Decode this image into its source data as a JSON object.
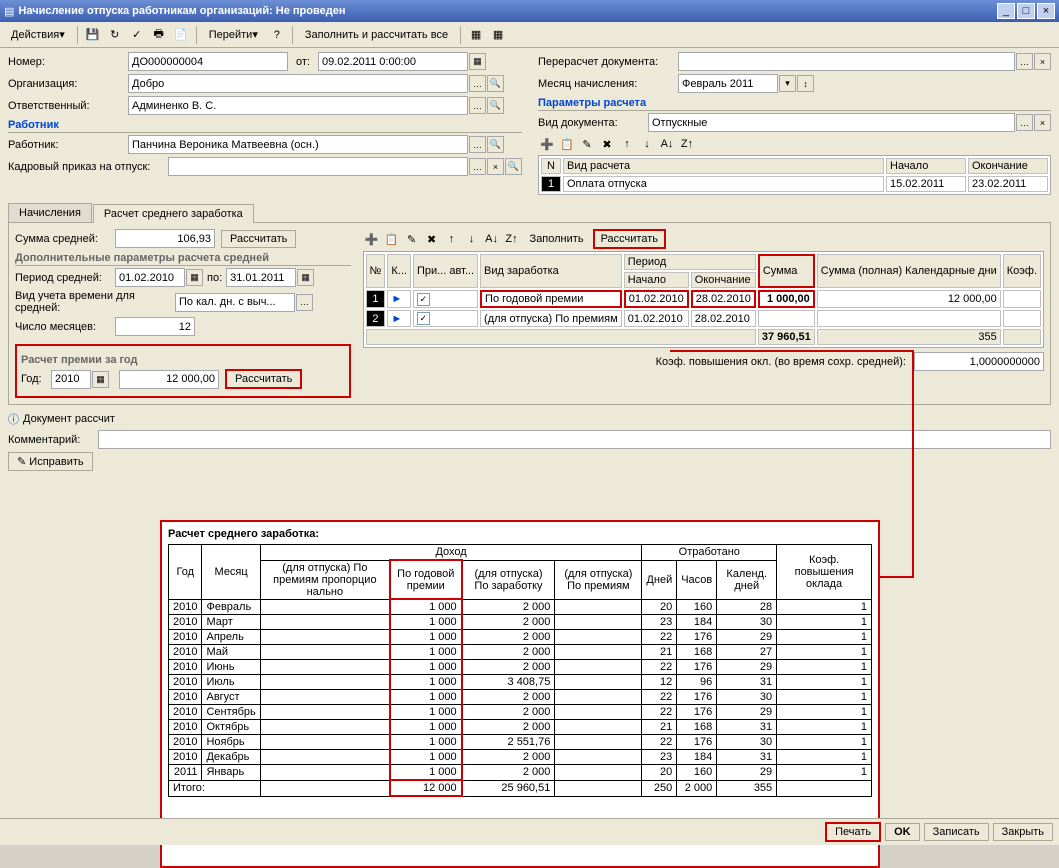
{
  "window": {
    "title": "Начисление отпуска работникам организаций: Не проведен",
    "actions_menu": "Действия",
    "navigate": "Перейти",
    "fill_calc_all": "Заполнить и рассчитать все"
  },
  "header": {
    "number_label": "Номер:",
    "number": "ДО000000004",
    "from_label": "от:",
    "from": "09.02.2011 0:00:00",
    "org_label": "Организация:",
    "org": "Добро",
    "resp_label": "Ответственный:",
    "resp": "Админенко В. С.",
    "recalc_label": "Перерасчет документа:",
    "recalc": "",
    "month_label": "Месяц начисления:",
    "month": "Февраль 2011"
  },
  "worker": {
    "group": "Работник",
    "label": "Работник:",
    "value": "Панчина Вероника Матвеевна (осн.)",
    "order_label": "Кадровый приказ на отпуск:",
    "order": ""
  },
  "params": {
    "group": "Параметры расчета",
    "doc_type_label": "Вид документа:",
    "doc_type": "Отпускные",
    "table": {
      "h_num": "N",
      "h_type": "Вид расчета",
      "h_start": "Начало",
      "h_end": "Окончание",
      "row": {
        "n": "1",
        "type": "Оплата отпуска",
        "start": "15.02.2011",
        "end": "23.02.2011"
      }
    }
  },
  "tabs": {
    "t1": "Начисления",
    "t2": "Расчет среднего заработка"
  },
  "avg_panel": {
    "sum_label": "Сумма средней:",
    "sum": "106,93",
    "calc_btn": "Рассчитать",
    "extra_group": "Дополнительные параметры расчета средней",
    "period_label": "Период средней:",
    "period_from": "01.02.2010",
    "period_to_label": "по:",
    "period_to": "31.01.2011",
    "time_label": "Вид учета времени для средней:",
    "time_value": "По кал. дн. с выч...",
    "months_label": "Число месяцев:",
    "months": "12",
    "bonus_group": "Расчет премии за год",
    "year_label": "Год:",
    "year": "2010",
    "year_sum": "12 000,00",
    "year_calc": "Рассчитать"
  },
  "grid_toolbar": {
    "fill": "Заполнить",
    "calc": "Рассчитать"
  },
  "chart_data": {
    "type": "table",
    "headers": {
      "num": "№",
      "k": "К...",
      "pri": "При...\nавт...",
      "zar": "Вид заработка",
      "period": "Период",
      "start": "Начало",
      "end": "Окончание",
      "sum": "Сумма",
      "sum_full": "Сумма (полная)\nКалендарные дни",
      "coef": "Коэф."
    },
    "rows": [
      {
        "n": "1",
        "chk": true,
        "zar": "По годовой премии",
        "start": "01.02.2010",
        "end": "28.02.2010",
        "sum": "1 000,00",
        "full": "12 000,00",
        "coef": ""
      },
      {
        "n": "2",
        "chk": true,
        "zar": "(для отпуска) По премиям",
        "start": "01.02.2010",
        "end": "28.02.2010",
        "sum": "",
        "full": "",
        "coef": ""
      }
    ],
    "totals": {
      "sum": "37 960,51",
      "days": "355"
    },
    "coef_label": "Коэф. повышения окл. (во время сохр. средней):",
    "coef_value": "1,0000000000"
  },
  "info_text": "Документ рассчит",
  "comment_label": "Комментарий:",
  "fix_btn": "Исправить",
  "overlay": {
    "title": "Расчет среднего заработка:",
    "headers": {
      "year": "Год",
      "month": "Месяц",
      "income": "Доход",
      "worked": "Отработано",
      "c1": "(для отпуска) По премиям пропорцио нально",
      "c2": "По годовой премии",
      "c3": "(для отпуска) По заработку",
      "c4": "(для отпуска) По премиям",
      "days": "Дней",
      "hours": "Часов",
      "cdays": "Календ. дней",
      "coef": "Коэф. повышения оклада"
    },
    "rows": [
      {
        "y": "2010",
        "m": "Февраль",
        "c2": "1 000",
        "c3": "2 000",
        "d": "20",
        "h": "160",
        "cd": "28",
        "coef": "1"
      },
      {
        "y": "2010",
        "m": "Март",
        "c2": "1 000",
        "c3": "2 000",
        "d": "23",
        "h": "184",
        "cd": "30",
        "coef": "1"
      },
      {
        "y": "2010",
        "m": "Апрель",
        "c2": "1 000",
        "c3": "2 000",
        "d": "22",
        "h": "176",
        "cd": "29",
        "coef": "1"
      },
      {
        "y": "2010",
        "m": "Май",
        "c2": "1 000",
        "c3": "2 000",
        "d": "21",
        "h": "168",
        "cd": "27",
        "coef": "1"
      },
      {
        "y": "2010",
        "m": "Июнь",
        "c2": "1 000",
        "c3": "2 000",
        "d": "22",
        "h": "176",
        "cd": "29",
        "coef": "1"
      },
      {
        "y": "2010",
        "m": "Июль",
        "c2": "1 000",
        "c3": "3 408,75",
        "d": "12",
        "h": "96",
        "cd": "31",
        "coef": "1"
      },
      {
        "y": "2010",
        "m": "Август",
        "c2": "1 000",
        "c3": "2 000",
        "d": "22",
        "h": "176",
        "cd": "30",
        "coef": "1"
      },
      {
        "y": "2010",
        "m": "Сентябрь",
        "c2": "1 000",
        "c3": "2 000",
        "d": "22",
        "h": "176",
        "cd": "29",
        "coef": "1"
      },
      {
        "y": "2010",
        "m": "Октябрь",
        "c2": "1 000",
        "c3": "2 000",
        "d": "21",
        "h": "168",
        "cd": "31",
        "coef": "1"
      },
      {
        "y": "2010",
        "m": "Ноябрь",
        "c2": "1 000",
        "c3": "2 551,76",
        "d": "22",
        "h": "176",
        "cd": "30",
        "coef": "1"
      },
      {
        "y": "2010",
        "m": "Декабрь",
        "c2": "1 000",
        "c3": "2 000",
        "d": "23",
        "h": "184",
        "cd": "31",
        "coef": "1"
      },
      {
        "y": "2011",
        "m": "Январь",
        "c2": "1 000",
        "c3": "2 000",
        "d": "20",
        "h": "160",
        "cd": "29",
        "coef": "1"
      }
    ],
    "total_label": "Итого:",
    "totals": {
      "c2": "12 000",
      "c3": "25 960,51",
      "d": "250",
      "h": "2 000",
      "cd": "355"
    }
  },
  "footer": {
    "print": "Печать",
    "ok": "OK",
    "save": "Записать",
    "close": "Закрыть"
  }
}
